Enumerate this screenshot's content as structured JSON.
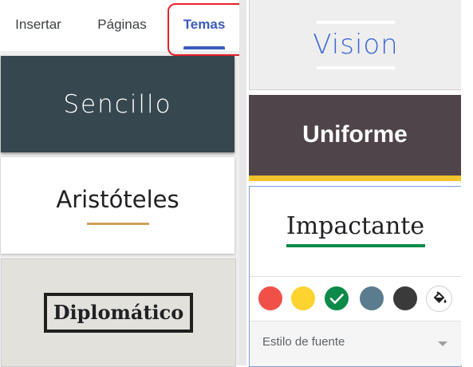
{
  "tabs": [
    {
      "label": "Insertar"
    },
    {
      "label": "Páginas"
    },
    {
      "label": "Temas",
      "active": true
    }
  ],
  "themes_left": [
    {
      "name": "Sencillo"
    },
    {
      "name": "Aristóteles"
    },
    {
      "name": "Diplomático"
    }
  ],
  "themes_right": [
    {
      "name": "Vision"
    },
    {
      "name": "Uniforme"
    },
    {
      "name": "Impactante",
      "selected": true
    }
  ],
  "colors": {
    "accent": "#3c5bbf",
    "highlight": "#e8212b",
    "swatches": [
      "#f15049",
      "#fcd32f",
      "#0d8a4a",
      "#5a7c8e",
      "#3a3a3a"
    ],
    "selected_swatch": "#0d8a4a"
  },
  "icons": {
    "check": "check-icon",
    "paint_bucket": "paint-bucket-icon",
    "dropdown": "chevron-down-icon"
  },
  "font_style": {
    "placeholder": "Estilo de fuente"
  }
}
